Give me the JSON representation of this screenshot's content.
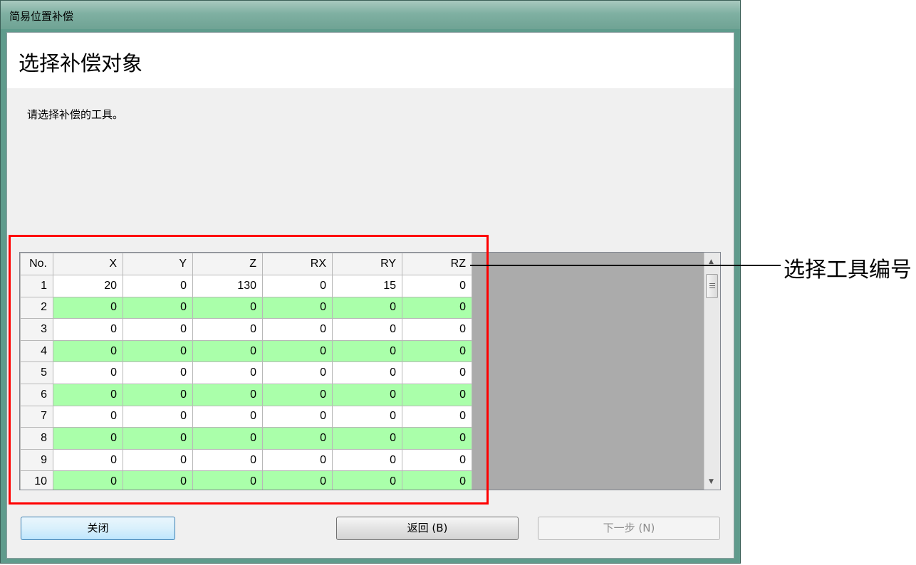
{
  "window": {
    "title": "简易位置补偿"
  },
  "header": {
    "heading": "选择补偿对象"
  },
  "instruction": "请选择补偿的工具。",
  "table": {
    "columns": [
      "No.",
      "X",
      "Y",
      "Z",
      "RX",
      "RY",
      "RZ"
    ],
    "rows": [
      [
        "1",
        "20",
        "0",
        "130",
        "0",
        "15",
        "0"
      ],
      [
        "2",
        "0",
        "0",
        "0",
        "0",
        "0",
        "0"
      ],
      [
        "3",
        "0",
        "0",
        "0",
        "0",
        "0",
        "0"
      ],
      [
        "4",
        "0",
        "0",
        "0",
        "0",
        "0",
        "0"
      ],
      [
        "5",
        "0",
        "0",
        "0",
        "0",
        "0",
        "0"
      ],
      [
        "6",
        "0",
        "0",
        "0",
        "0",
        "0",
        "0"
      ],
      [
        "7",
        "0",
        "0",
        "0",
        "0",
        "0",
        "0"
      ],
      [
        "8",
        "0",
        "0",
        "0",
        "0",
        "0",
        "0"
      ],
      [
        "9",
        "0",
        "0",
        "0",
        "0",
        "0",
        "0"
      ],
      [
        "10",
        "0",
        "0",
        "0",
        "0",
        "0",
        "0"
      ]
    ]
  },
  "buttons": {
    "close": "关闭",
    "back": "返回 (B)",
    "next": "下一步 (N)"
  },
  "annotation": {
    "label": "选择工具编号"
  },
  "colors": {
    "alt_row": "#aaffaa",
    "highlight": "#ff0000"
  }
}
